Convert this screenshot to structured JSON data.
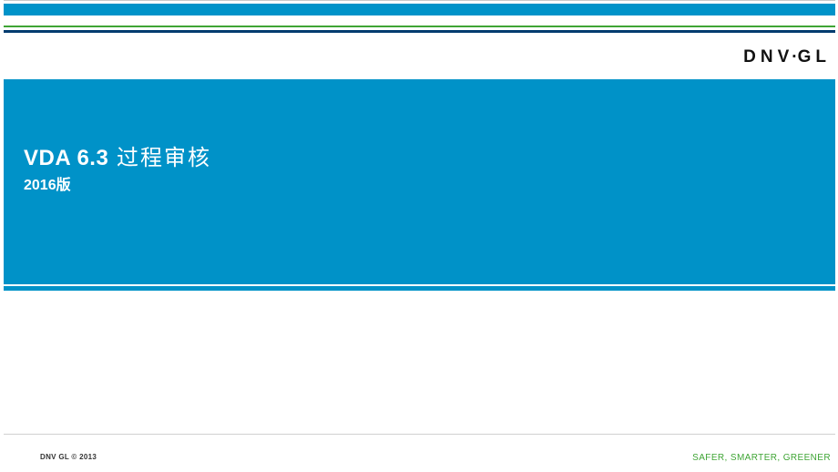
{
  "logo": {
    "part1": "DNV",
    "dot": "·",
    "part2": "GL"
  },
  "hero": {
    "title_strong": "VDA 6.3",
    "title_rest": " 过程审核",
    "subtitle": "2016版"
  },
  "footer": {
    "left": "DNV GL © 2013",
    "right": "SAFER, SMARTER, GREENER"
  }
}
